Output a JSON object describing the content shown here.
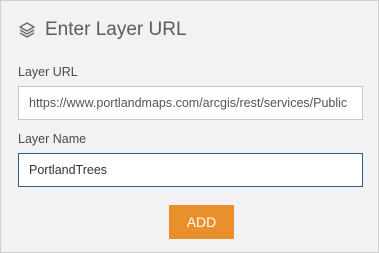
{
  "header": {
    "title": "Enter Layer URL",
    "icon": "layers-icon"
  },
  "url_field": {
    "label": "Layer URL",
    "value": "https://www.portlandmaps.com/arcgis/rest/services/Public"
  },
  "name_field": {
    "label": "Layer Name",
    "value": "PortlandTrees"
  },
  "add_button": {
    "label": "ADD"
  },
  "colors": {
    "accent": "#e98f2c",
    "focus_border": "#2f5d8a",
    "background": "#f2f2f2"
  }
}
